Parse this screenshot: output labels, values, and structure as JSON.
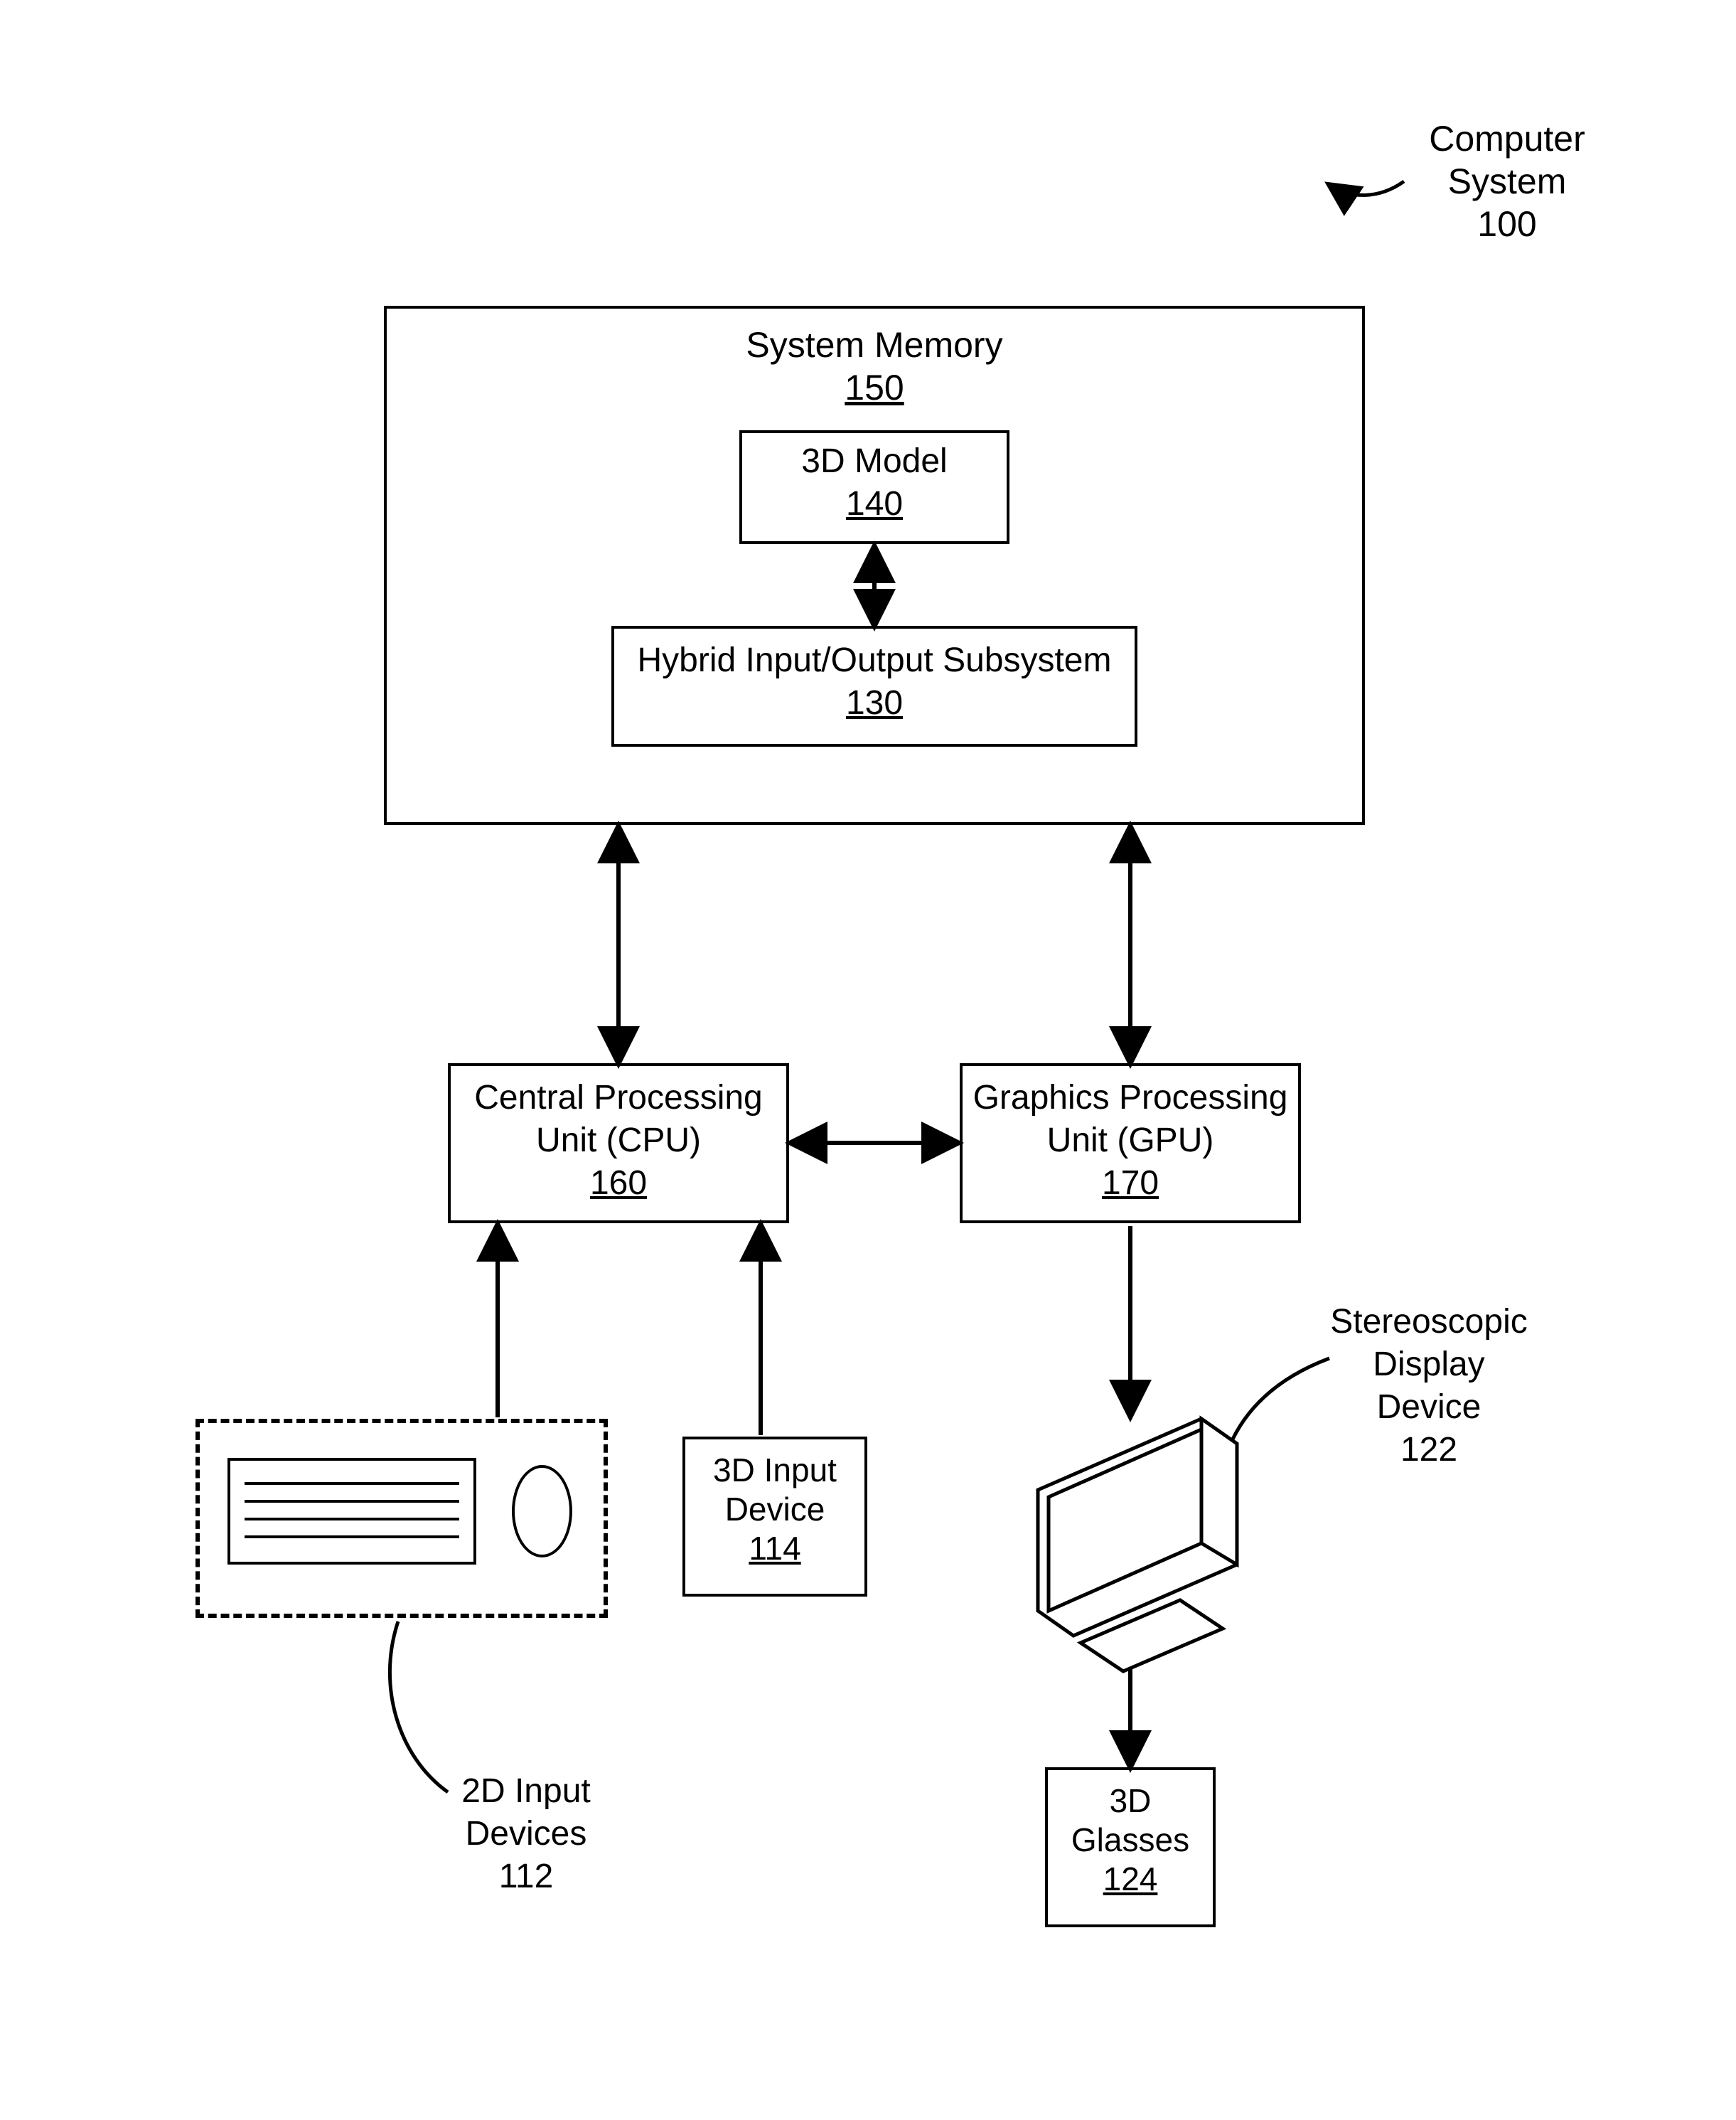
{
  "title": {
    "line1": "Computer",
    "line2": "System",
    "ref": "100"
  },
  "memory": {
    "label": "System Memory",
    "ref": "150"
  },
  "model": {
    "label": "3D Model",
    "ref": "140"
  },
  "hybrid": {
    "label": "Hybrid Input/Output Subsystem",
    "ref": "130"
  },
  "cpu": {
    "line1": "Central Processing",
    "line2": "Unit (CPU)",
    "ref": "160"
  },
  "gpu": {
    "line1": "Graphics Processing",
    "line2": "Unit (GPU)",
    "ref": "170"
  },
  "dev3d": {
    "line1": "3D Input",
    "line2": "Device",
    "ref": "114"
  },
  "dev2d": {
    "line1": "2D Input",
    "line2": "Devices",
    "ref": "112"
  },
  "disp": {
    "line1": "Stereoscopic",
    "line2": "Display",
    "line3": "Device",
    "ref": "122"
  },
  "glasses": {
    "line1": "3D",
    "line2": "Glasses",
    "ref": "124"
  }
}
